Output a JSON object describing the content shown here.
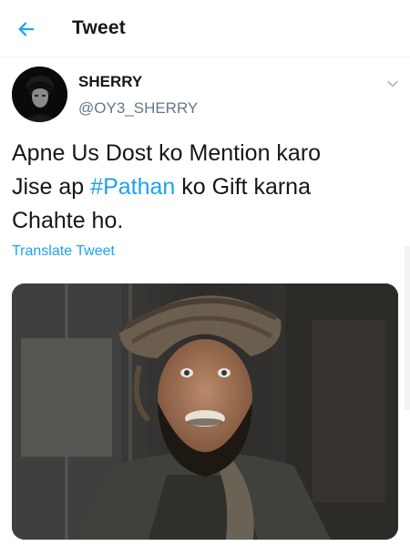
{
  "header": {
    "title": "Tweet",
    "back_icon": "arrow-left-icon",
    "accent": "#1da1f2"
  },
  "author": {
    "name": "SHERRY",
    "handle": "@OY3_SHERRY",
    "menu_icon": "chevron-down-icon"
  },
  "tweet": {
    "text_line1": "Apne Us Dost ko Mention karo",
    "text_line2_prefix": "Jise ap ",
    "hashtag": "#Pathan",
    "text_line2_suffix": " ko Gift karna",
    "text_line3": "Chahte ho.",
    "translate_label": "Translate Tweet"
  }
}
